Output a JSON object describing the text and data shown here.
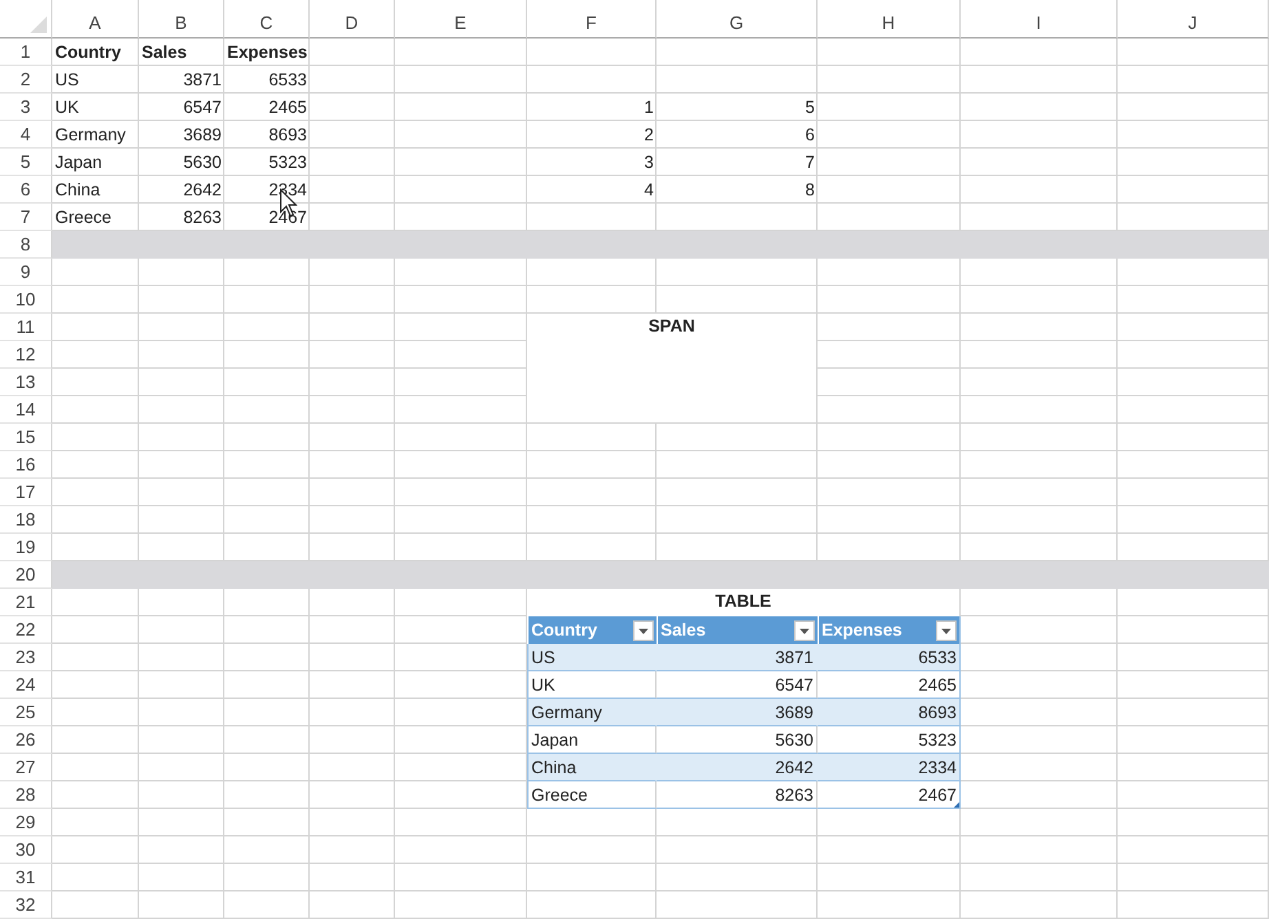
{
  "columns": [
    {
      "label": "A"
    },
    {
      "label": "B"
    },
    {
      "label": "C"
    },
    {
      "label": "D"
    },
    {
      "label": "E"
    },
    {
      "label": "F"
    },
    {
      "label": "G"
    },
    {
      "label": "H"
    },
    {
      "label": "I"
    },
    {
      "label": "J"
    }
  ],
  "rows": [
    {
      "label": "1",
      "shaded": false
    },
    {
      "label": "2",
      "shaded": false
    },
    {
      "label": "3",
      "shaded": false
    },
    {
      "label": "4",
      "shaded": false
    },
    {
      "label": "5",
      "shaded": false
    },
    {
      "label": "6",
      "shaded": false
    },
    {
      "label": "7",
      "shaded": false
    },
    {
      "label": "8",
      "shaded": true
    },
    {
      "label": "9",
      "shaded": false
    },
    {
      "label": "10",
      "shaded": false
    },
    {
      "label": "11",
      "shaded": false
    },
    {
      "label": "12",
      "shaded": false
    },
    {
      "label": "13",
      "shaded": false
    },
    {
      "label": "14",
      "shaded": false
    },
    {
      "label": "15",
      "shaded": false
    },
    {
      "label": "16",
      "shaded": false
    },
    {
      "label": "17",
      "shaded": false
    },
    {
      "label": "18",
      "shaded": false
    },
    {
      "label": "19",
      "shaded": false
    },
    {
      "label": "20",
      "shaded": true
    },
    {
      "label": "21",
      "shaded": false
    },
    {
      "label": "22",
      "shaded": false
    },
    {
      "label": "23",
      "shaded": false
    },
    {
      "label": "24",
      "shaded": false
    },
    {
      "label": "25",
      "shaded": false
    },
    {
      "label": "26",
      "shaded": false
    },
    {
      "label": "27",
      "shaded": false
    },
    {
      "label": "28",
      "shaded": false
    },
    {
      "label": "29",
      "shaded": false
    },
    {
      "label": "30",
      "shaded": false
    },
    {
      "label": "31",
      "shaded": false
    },
    {
      "label": "32",
      "shaded": false
    }
  ],
  "data_block": {
    "header": [
      "Country",
      "Sales",
      "Expenses"
    ],
    "rows": [
      [
        "US",
        "3871",
        "6533"
      ],
      [
        "UK",
        "6547",
        "2465"
      ],
      [
        "Germany",
        "3689",
        "8693"
      ],
      [
        "Japan",
        "5630",
        "5323"
      ],
      [
        "China",
        "2642",
        "2334"
      ],
      [
        "Greece",
        "8263",
        "2467"
      ]
    ]
  },
  "number_block": {
    "rows": [
      [
        "1",
        "5"
      ],
      [
        "2",
        "6"
      ],
      [
        "3",
        "7"
      ],
      [
        "4",
        "8"
      ]
    ]
  },
  "span_cell": {
    "text": "SPAN"
  },
  "table": {
    "title": "TABLE",
    "columns": [
      {
        "label": "Country",
        "filter_button": true
      },
      {
        "label": "Sales",
        "filter_button": true
      },
      {
        "label": "Expenses",
        "filter_button": true
      }
    ],
    "rows": [
      [
        "US",
        "3871",
        "6533"
      ],
      [
        "UK",
        "6547",
        "2465"
      ],
      [
        "Germany",
        "3689",
        "8693"
      ],
      [
        "Japan",
        "5630",
        "5323"
      ],
      [
        "China",
        "2642",
        "2334"
      ],
      [
        "Greece",
        "8263",
        "2467"
      ]
    ]
  }
}
